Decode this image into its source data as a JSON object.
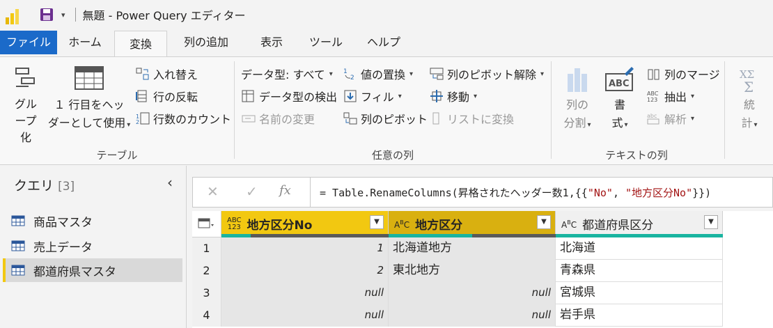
{
  "titlebar": {
    "title": "無題 - Power Query エディター"
  },
  "tabs": [
    {
      "label": "ファイル"
    },
    {
      "label": "ホーム"
    },
    {
      "label": "変換"
    },
    {
      "label": "列の追加"
    },
    {
      "label": "表示"
    },
    {
      "label": "ツール"
    },
    {
      "label": "ヘルプ"
    }
  ],
  "ribbon": {
    "table_group": {
      "label": "テーブル",
      "group_by": "グループ化",
      "use_first_row_1": "１ 行目をヘッ",
      "use_first_row_2": "ダーとして使用",
      "transpose": "入れ替え",
      "reverse_rows": "行の反転",
      "count_rows": "行数のカウント"
    },
    "any_column_group": {
      "label": "任意の列",
      "data_type": "データ型: すべて",
      "detect_type": "データ型の検出",
      "rename": "名前の変更",
      "replace_values": "値の置換",
      "fill": "フィル",
      "pivot": "列のピボット",
      "unpivot": "列のピボット解除",
      "move": "移動",
      "convert_to_list": "リストに変換"
    },
    "text_column_group": {
      "label": "テキストの列",
      "split_1": "列の",
      "split_2": "分割",
      "format_1": "書",
      "format_2": "式",
      "merge": "列のマージ",
      "extract": "抽出",
      "parse": "解析"
    },
    "number_group": {
      "stats_1": "統",
      "stats_2": "計"
    }
  },
  "queries": {
    "header": "クエリ",
    "count": "[3]",
    "items": [
      {
        "label": "商品マスタ"
      },
      {
        "label": "売上データ"
      },
      {
        "label": "都道府県マスタ"
      }
    ]
  },
  "formula": {
    "prefix": "= Table.RenameColumns(昇格されたヘッダー数1,{{",
    "str1": "\"No\"",
    "mid": ", ",
    "str2": "\"地方区分No\"",
    "suffix": "}})"
  },
  "grid": {
    "columns": [
      {
        "type": "ABC 123",
        "label": "地方区分No"
      },
      {
        "type": "ABC",
        "label": "地方区分"
      },
      {
        "type": "ABC",
        "label": "都道府県区分"
      }
    ],
    "rows": [
      {
        "n": "1",
        "c1": "1",
        "c2": "北海道地方",
        "c3": "北海道"
      },
      {
        "n": "2",
        "c1": "2",
        "c2": "東北地方",
        "c3": "青森県"
      },
      {
        "n": "3",
        "c1": "null",
        "c2": "null",
        "c3": "宮城県"
      },
      {
        "n": "4",
        "c1": "null",
        "c2": "null",
        "c3": "岩手県"
      }
    ]
  },
  "colors": {
    "accent": "#f2c811",
    "file_tab": "#1b6ac9",
    "header_selected": "#f2c811",
    "header_selected2": "#d9b010",
    "quality_bar": "#19b4a0"
  }
}
